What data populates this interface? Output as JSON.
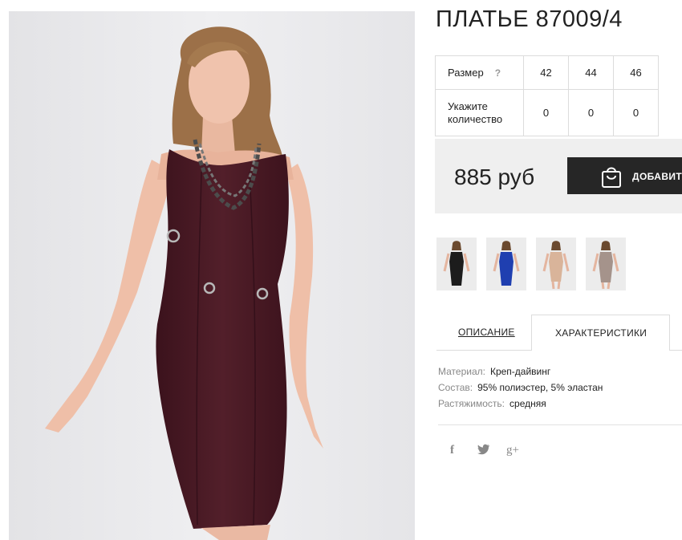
{
  "product": {
    "title": "ПЛАТЬЕ 87009/4"
  },
  "size_table": {
    "size_label": "Размер",
    "help_icon": "?",
    "sizes": [
      "42",
      "44",
      "46"
    ],
    "qty_label_line1": "Укажите",
    "qty_label_line2": "количество",
    "quantities": [
      "0",
      "0",
      "0"
    ]
  },
  "purchase": {
    "price": "885 руб",
    "add_button_label": "ДОБАВИТЬ",
    "add_button_icon": "shopping-bag-icon"
  },
  "thumbnails": [
    {
      "name": "black-dress",
      "color": "#1c1c1c"
    },
    {
      "name": "blue-dress",
      "color": "#1f3fb0"
    },
    {
      "name": "beige-dress",
      "color": "#d9b49a"
    },
    {
      "name": "grey-dress",
      "color": "#a5938b"
    }
  ],
  "tabs": {
    "description": "ОПИСАНИЕ",
    "characteristics": "ХАРАКТЕРИСТИКИ",
    "active": "characteristics"
  },
  "specs": [
    {
      "key": "Материал:",
      "value": "Креп-дайвинг"
    },
    {
      "key": "Состав:",
      "value": "95% полиэстер, 5% эластан"
    },
    {
      "key": "Растяжимость:",
      "value": "средняя"
    }
  ],
  "social": {
    "facebook": "f",
    "twitter": "t",
    "google_plus": "g+"
  },
  "colors": {
    "dress": "#4a1a24",
    "button_bg": "#262626",
    "price_bg": "#efefef"
  }
}
